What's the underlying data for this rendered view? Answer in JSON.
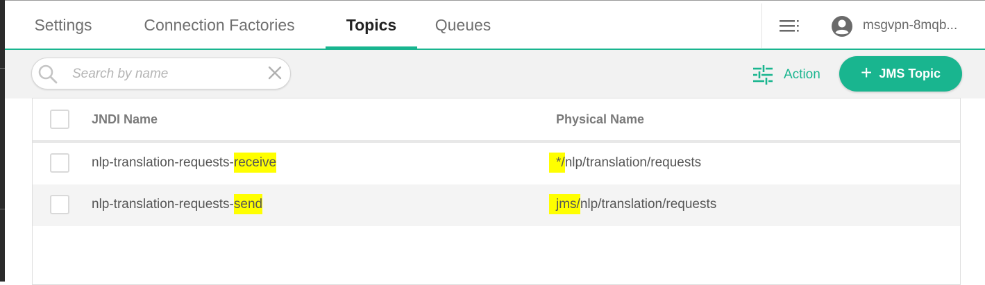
{
  "tabs": [
    {
      "label": "Settings",
      "active": false
    },
    {
      "label": "Connection Factories",
      "active": false
    },
    {
      "label": "Topics",
      "active": true
    },
    {
      "label": "Queues",
      "active": false
    }
  ],
  "user": {
    "vpn_name": "msgvpn-8mqb..."
  },
  "search": {
    "placeholder": "Search by name",
    "value": ""
  },
  "toolbar": {
    "action_label": "Action",
    "add_label": "JMS Topic"
  },
  "table": {
    "columns": [
      "JNDI Name",
      "Physical Name"
    ],
    "rows": [
      {
        "jndi_prefix": "nlp-translation-requests-",
        "jndi_highlight": "receive",
        "physical_highlight": "*/",
        "physical_rest": "nlp/translation/requests"
      },
      {
        "jndi_prefix": "nlp-translation-requests-",
        "jndi_highlight": "send",
        "physical_highlight": "jms/",
        "physical_rest": "nlp/translation/requests"
      }
    ]
  },
  "colors": {
    "accent": "#19b58f",
    "highlight": "#ffff00"
  }
}
